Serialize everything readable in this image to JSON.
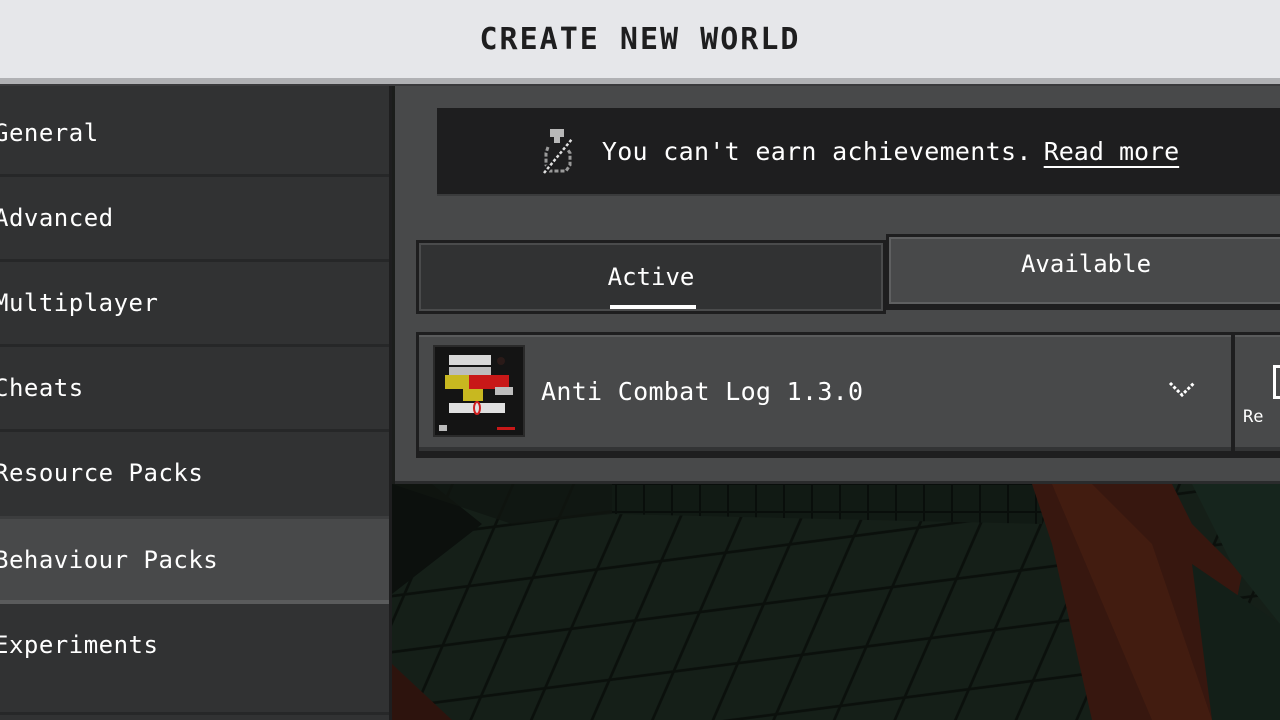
{
  "header": {
    "title": "CREATE NEW WORLD"
  },
  "sidebar": {
    "items": [
      {
        "label": "General",
        "active": false
      },
      {
        "label": "Advanced",
        "active": false
      },
      {
        "label": "Multiplayer",
        "active": false
      },
      {
        "label": "Cheats",
        "active": false
      },
      {
        "label": "Resource Packs",
        "active": false
      },
      {
        "label": "Behaviour Packs",
        "active": true
      },
      {
        "label": "Experiments",
        "active": false
      }
    ]
  },
  "banner": {
    "icon": "achievements-disabled-icon",
    "text": "You can't earn achievements.",
    "link": "Read more"
  },
  "tabs": [
    {
      "label": "Active",
      "selected": true
    },
    {
      "label": "Available",
      "selected": false
    }
  ],
  "packs": [
    {
      "name": "Anti Combat Log 1.3.0",
      "thumbnail_text": "ANTI COMBAT LOG",
      "expand_icon": "chevron-down-icon",
      "side_action_label": "Re"
    }
  ],
  "colors": {
    "header_bg": "#e6e7ea",
    "panel_bg": "#48494a",
    "sidebar_bg": "#313233",
    "banner_bg": "#1e1e1f",
    "selected_item_bg": "#48494a"
  }
}
